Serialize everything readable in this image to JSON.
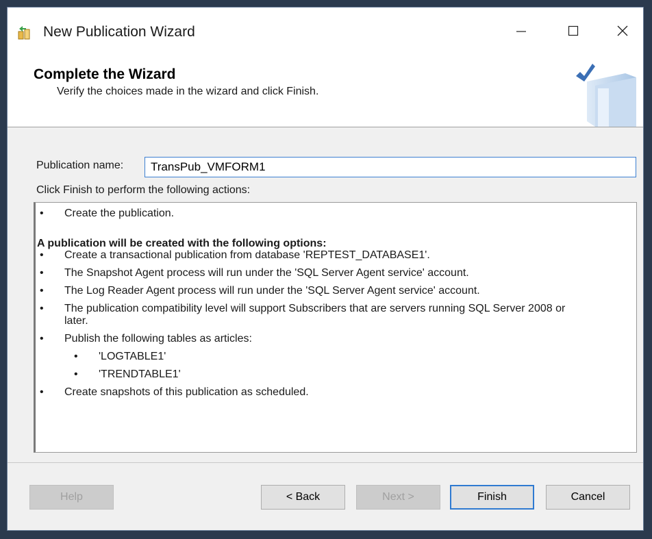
{
  "window": {
    "title": "New Publication Wizard",
    "app_icon": "sql-server-replication-icon",
    "controls": [
      "minimize-icon",
      "maximize-icon",
      "close-icon"
    ]
  },
  "header": {
    "title": "Complete the Wizard",
    "subtitle": "Verify the choices made in the wizard and click Finish.",
    "graphic": "book-checkmark-icon"
  },
  "form": {
    "publication_name_label": "Publication name:",
    "publication_name_value": "TransPub_VMFORM1",
    "actions_label": "Click Finish to perform the following actions:"
  },
  "actions": {
    "first": "Create the publication.",
    "options_heading": "A publication will be created with the following options:",
    "items": [
      "Create a transactional publication from database 'REPTEST_DATABASE1'.",
      "The Snapshot Agent process will run under the 'SQL Server Agent service' account.",
      "The Log Reader Agent process will run under the 'SQL Server Agent service' account.",
      "The publication compatibility level will support Subscribers that are servers running SQL Server 2008 or",
      "later.",
      "Publish the following tables as articles:"
    ],
    "tables": [
      "'LOGTABLE1'",
      "'TRENDTABLE1'"
    ],
    "last": "Create snapshots of this publication as scheduled.",
    "bullet": "•"
  },
  "buttons": {
    "help": "Help",
    "back": "< Back",
    "next": "Next >",
    "finish": "Finish",
    "cancel": "Cancel"
  },
  "colors": {
    "focus_border": "#3c7fd1",
    "default_button_border": "#2f7ad1",
    "desktop": "#2b3a4e"
  }
}
